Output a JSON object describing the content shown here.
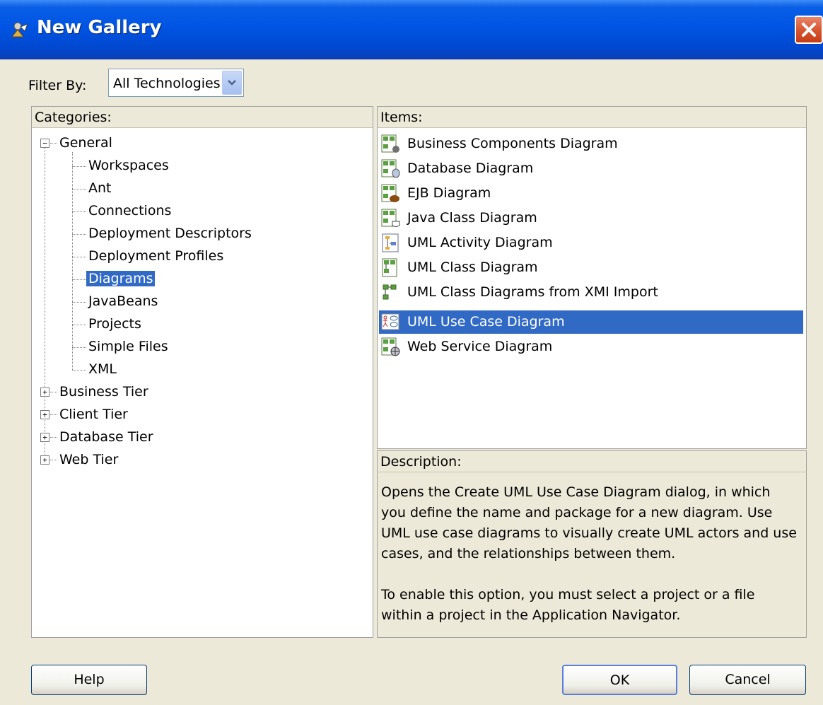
{
  "window": {
    "title": "New Gallery"
  },
  "filter": {
    "label": "Filter By:",
    "selected": "All Technologies"
  },
  "categories": {
    "header": "Categories:",
    "general": "General",
    "general_children": [
      "Workspaces",
      "Ant",
      "Connections",
      "Deployment Descriptors",
      "Deployment Profiles",
      "Diagrams",
      "JavaBeans",
      "Projects",
      "Simple Files",
      "XML"
    ],
    "collapsed": [
      "Business Tier",
      "Client Tier",
      "Database Tier",
      "Web Tier"
    ],
    "selected": "Diagrams"
  },
  "items": {
    "header": "Items:",
    "list": [
      {
        "label": "Business Components Diagram",
        "icon": "business-components-diagram-icon"
      },
      {
        "label": "Database Diagram",
        "icon": "database-diagram-icon"
      },
      {
        "label": "EJB Diagram",
        "icon": "ejb-diagram-icon"
      },
      {
        "label": "Java Class Diagram",
        "icon": "java-class-diagram-icon"
      },
      {
        "label": "UML Activity Diagram",
        "icon": "uml-activity-diagram-icon"
      },
      {
        "label": "UML Class Diagram",
        "icon": "uml-class-diagram-icon"
      },
      {
        "label": "UML Class Diagrams from XMI Import",
        "icon": "xmi-import-diagram-icon"
      },
      {
        "label": "UML Use Case Diagram",
        "icon": "uml-use-case-diagram-icon"
      },
      {
        "label": "Web Service Diagram",
        "icon": "web-service-diagram-icon"
      }
    ],
    "selected": "UML Use Case Diagram"
  },
  "description": {
    "header": "Description:",
    "para1": "Opens the Create UML Use Case Diagram dialog, in which you define the name and package for a new diagram.  Use UML use case diagrams to visually create UML actors and use cases, and the relationships between them.",
    "para2": "To enable this option, you must select a project or a file within a project in the Application Navigator."
  },
  "buttons": {
    "help": "Help",
    "ok": "OK",
    "cancel": "Cancel"
  },
  "colors": {
    "selection": "#316ac5",
    "titlebar": "#0054e3",
    "dialog_bg": "#ece9d8"
  }
}
